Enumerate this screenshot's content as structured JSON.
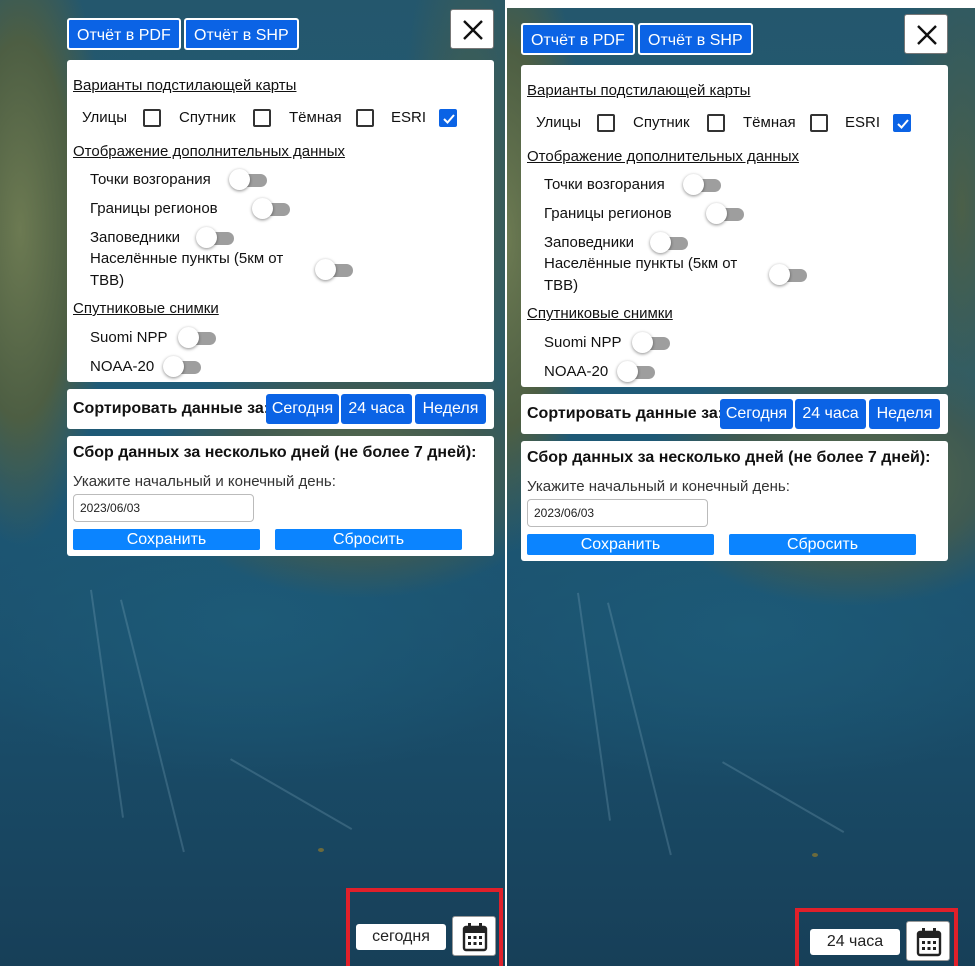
{
  "screens": [
    {
      "pdf_button": "Отчёт в PDF",
      "shp_button": "Отчёт в SHP",
      "basemap_title": "Варианты подстилающей карты",
      "basemaps": [
        {
          "label": "Улицы",
          "checked": false
        },
        {
          "label": "Спутник",
          "checked": false
        },
        {
          "label": "Тёмная",
          "checked": false
        },
        {
          "label": "ESRI",
          "checked": true
        }
      ],
      "extra_title": "Отображение дополнительных данных",
      "extra_layers": [
        {
          "label": "Точки возгорания",
          "on": false
        },
        {
          "label": "Границы регионов",
          "on": false
        },
        {
          "label": "Заповедники",
          "on": false
        },
        {
          "label": "Населённые пункты (5км от ТВВ)",
          "on": false
        }
      ],
      "satellite_title": "Спутниковые снимки",
      "satellites": [
        {
          "label": "Suomi NPP",
          "on": false
        },
        {
          "label": "NOAA-20",
          "on": false
        }
      ],
      "sort_label": "Сортировать данные за:",
      "sort_buttons": [
        "Сегодня",
        "24 часа",
        "Неделя"
      ],
      "collect_title": "Сбор данных за несколько дней (не более 7 дней):",
      "collect_hint": "Укажите начальный и конечный день:",
      "date_value": "2023/06/03",
      "save_button": "Сохранить",
      "reset_button": "Сбросить",
      "period_badge": "сегодня"
    },
    {
      "pdf_button": "Отчёт в PDF",
      "shp_button": "Отчёт в SHP",
      "basemap_title": "Варианты подстилающей карты",
      "basemaps": [
        {
          "label": "Улицы",
          "checked": false
        },
        {
          "label": "Спутник",
          "checked": false
        },
        {
          "label": "Тёмная",
          "checked": false
        },
        {
          "label": "ESRI",
          "checked": true
        }
      ],
      "extra_title": "Отображение дополнительных данных",
      "extra_layers": [
        {
          "label": "Точки возгорания",
          "on": false
        },
        {
          "label": "Границы регионов",
          "on": false
        },
        {
          "label": "Заповедники",
          "on": false
        },
        {
          "label": "Населённые пункты (5км от ТВВ)",
          "on": false
        }
      ],
      "satellite_title": "Спутниковые снимки",
      "satellites": [
        {
          "label": "Suomi NPP",
          "on": false
        },
        {
          "label": "NOAA-20",
          "on": false
        }
      ],
      "sort_label": "Сортировать данные за:",
      "sort_buttons": [
        "Сегодня",
        "24 часа",
        "Неделя"
      ],
      "collect_title": "Сбор данных за несколько дней (не более 7 дней):",
      "collect_hint": "Укажите начальный и конечный день:",
      "date_value": "2023/06/03",
      "save_button": "Сохранить",
      "reset_button": "Сбросить",
      "period_badge": "24 часа"
    }
  ],
  "icons": {
    "close": "close-icon",
    "calendar": "calendar-icon",
    "check": "check-icon"
  },
  "colors": {
    "primary": "#0b63e5",
    "action": "#0b84ff",
    "highlight": "#e0202a",
    "toggle_off": "#9e9e9e"
  }
}
